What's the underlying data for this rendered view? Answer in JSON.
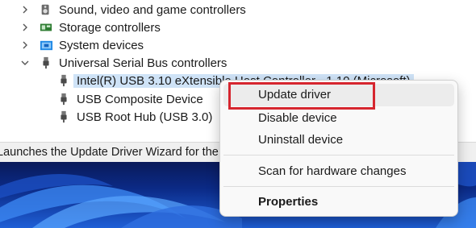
{
  "tree": {
    "items": [
      {
        "label": "Sound, video and game controllers",
        "expanded": false,
        "icon": "speaker-icon"
      },
      {
        "label": "Storage controllers",
        "expanded": false,
        "icon": "storage-controller-icon"
      },
      {
        "label": "System devices",
        "expanded": false,
        "icon": "system-devices-icon"
      },
      {
        "label": "Universal Serial Bus controllers",
        "expanded": true,
        "icon": "usb-plug-icon"
      },
      {
        "label": "Intel(R) USB 3.10 eXtensible Host Controller - 1.10 (Microsoft)",
        "selected": true,
        "icon": "usb-plug-icon"
      },
      {
        "label": "USB Composite Device",
        "icon": "usb-plug-icon"
      },
      {
        "label": "USB Root Hub (USB 3.0)",
        "icon": "usb-plug-icon"
      }
    ]
  },
  "status_bar": {
    "text": "Launches the Update Driver Wizard for the selected device."
  },
  "context_menu": {
    "items": [
      {
        "label": "Update driver",
        "highlighted": true
      },
      {
        "label": "Disable device"
      },
      {
        "label": "Uninstall device"
      },
      {
        "label": "Scan for hardware changes"
      },
      {
        "label": "Properties",
        "bold": true
      }
    ]
  },
  "colors": {
    "selection": "#cfe3f7",
    "callout": "#d6262f",
    "desktop": "#0b2a86"
  }
}
